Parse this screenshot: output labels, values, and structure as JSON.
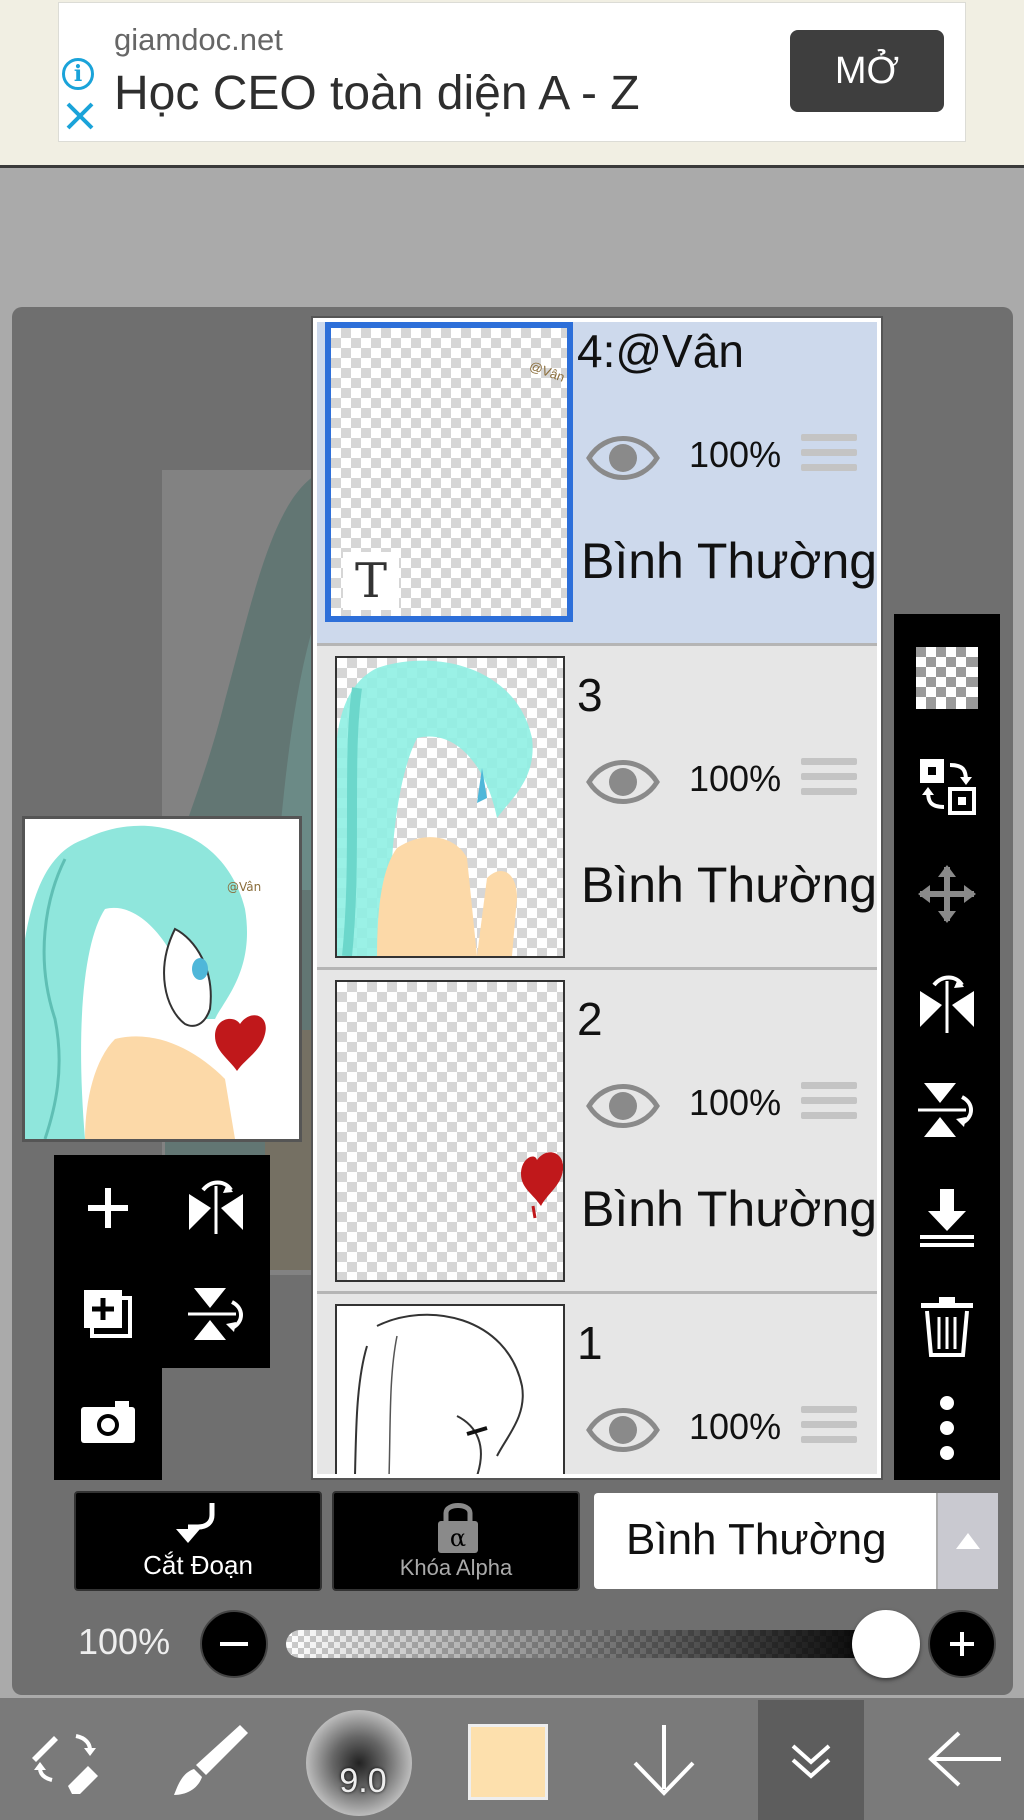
{
  "ad": {
    "domain": "giamdoc.net",
    "title": "Học CEO toàn diện A - Z",
    "open_label": "MỞ"
  },
  "layers": [
    {
      "name": "4:@Vân",
      "opacity": "100%",
      "blend": "Bình Thường",
      "selected": true,
      "type": "text",
      "type_badge": "T"
    },
    {
      "name": "3",
      "opacity": "100%",
      "blend": "Bình Thường",
      "selected": false
    },
    {
      "name": "2",
      "opacity": "100%",
      "blend": "Bình Thường",
      "selected": false
    },
    {
      "name": "1",
      "opacity": "100%",
      "blend": "Bình Thường",
      "selected": false
    }
  ],
  "controls": {
    "clip_label": "Cắt Đoạn",
    "alpha_lock_label": "Khóa Alpha",
    "blend_mode": "Bình Thường",
    "opacity_label": "100%"
  },
  "toolbar": {
    "brush_size": "9.0",
    "current_color": "#fde0ad"
  },
  "colors": {
    "selected_layer_bg": "#cdd9ec",
    "selected_border": "#2d6fd9",
    "hair": "#7ee6d9",
    "skin": "#fcd9a8",
    "heart": "#c0181b"
  }
}
